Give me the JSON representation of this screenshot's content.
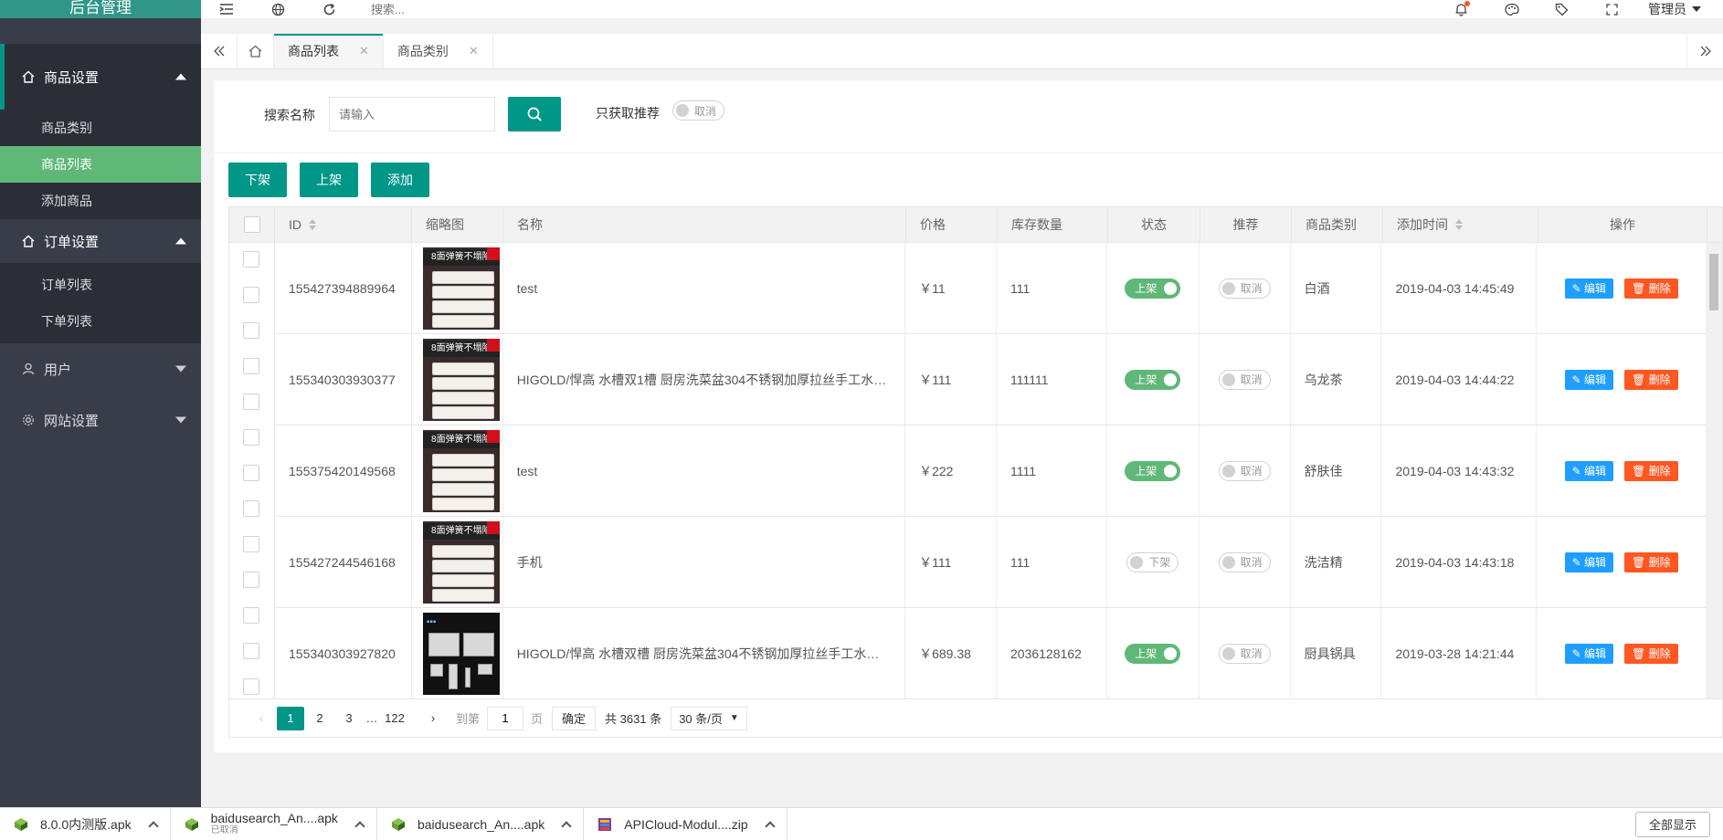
{
  "app": {
    "title": "后台管理"
  },
  "sidebar": {
    "groups": [
      {
        "label": "商品设置",
        "expanded": true,
        "items": [
          {
            "label": "商品类别",
            "active": false
          },
          {
            "label": "商品列表",
            "active": true
          },
          {
            "label": "添加商品",
            "active": false
          }
        ]
      },
      {
        "label": "订单设置",
        "expanded": true,
        "items": [
          {
            "label": "订单列表",
            "active": false
          },
          {
            "label": "下单列表",
            "active": false
          }
        ]
      },
      {
        "label": "用户",
        "expanded": false,
        "items": []
      },
      {
        "label": "网站设置",
        "expanded": false,
        "items": []
      }
    ]
  },
  "topbar": {
    "search_placeholder": "搜索...",
    "admin_label": "管理员",
    "icons": [
      "menu-toggle-icon",
      "globe-icon",
      "refresh-icon",
      "bell-icon",
      "palette-icon",
      "tag-icon",
      "fullscreen-icon"
    ]
  },
  "tabs": [
    {
      "label": "商品列表",
      "active": true
    },
    {
      "label": "商品类别",
      "active": false
    }
  ],
  "search": {
    "label": "搜索名称",
    "placeholder": "请输入",
    "recommend_label": "只获取推荐",
    "recommend_toggle": "取消"
  },
  "actions": {
    "off_shelf": "下架",
    "on_shelf": "上架",
    "add": "添加"
  },
  "table": {
    "headers": {
      "id": "ID",
      "thumb": "缩略图",
      "name": "名称",
      "price": "价格",
      "stock": "库存数量",
      "status": "状态",
      "recommend": "推荐",
      "category": "商品类别",
      "added": "添加时间",
      "ops": "操作"
    },
    "edit_label": "编辑",
    "delete_label": "删除",
    "thumb_banner": "8面弹簧不塌陷",
    "rows": [
      {
        "id": "155427394889964",
        "name": "test",
        "price": "￥11",
        "stock": "111",
        "status": "上架",
        "status_on": true,
        "recommend": "取消",
        "category": "白酒",
        "added": "2019-04-03 14:45:49",
        "thumb": "mattress"
      },
      {
        "id": "155340303930377",
        "name": "HIGOLD/悍高 水槽双1槽 厨房洗菜盆304不锈钢加厚拉丝手工水…",
        "price": "￥111",
        "stock": "111111",
        "status": "上架",
        "status_on": true,
        "recommend": "取消",
        "category": "乌龙茶",
        "added": "2019-04-03 14:44:22",
        "thumb": "mattress"
      },
      {
        "id": "155375420149568",
        "name": "test",
        "price": "￥222",
        "stock": "1111",
        "status": "上架",
        "status_on": true,
        "recommend": "取消",
        "category": "舒肤佳",
        "added": "2019-04-03 14:43:32",
        "thumb": "mattress"
      },
      {
        "id": "155427244546168",
        "name": "手机",
        "price": "￥111",
        "stock": "111",
        "status": "下架",
        "status_on": false,
        "recommend": "取消",
        "category": "洗洁精",
        "added": "2019-04-03 14:43:18",
        "thumb": "mattress"
      },
      {
        "id": "155340303927820",
        "name": "HIGOLD/悍高 水槽双槽 厨房洗菜盆304不锈钢加厚拉丝手工水…",
        "price": "￥689.38",
        "stock": "2036128162",
        "status": "上架",
        "status_on": true,
        "recommend": "取消",
        "category": "厨具锅具",
        "added": "2019-03-28 14:21:44",
        "thumb": "sink"
      }
    ]
  },
  "pagination": {
    "prev": "‹",
    "pages": [
      "1",
      "2",
      "3"
    ],
    "ellipsis": "…",
    "last": "122",
    "next": "›",
    "goto_label": "到第",
    "goto_value": "1",
    "page_unit": "页",
    "confirm": "确定",
    "total": "共 3631 条",
    "per_page": "30 条/页"
  },
  "downloads": {
    "items": [
      {
        "name": "8.0.0内测版.apk",
        "sub": ""
      },
      {
        "name": "baidusearch_An....apk",
        "sub": "已取消"
      },
      {
        "name": "baidusearch_An....apk",
        "sub": ""
      },
      {
        "name": "APICloud-Modul....zip",
        "sub": ""
      }
    ],
    "show_all": "全部显示"
  },
  "colors": {
    "primary": "#009688",
    "sidebar": "#393d49",
    "active_item": "#5fb878",
    "edit": "#1e9fff",
    "delete": "#ff5722"
  }
}
